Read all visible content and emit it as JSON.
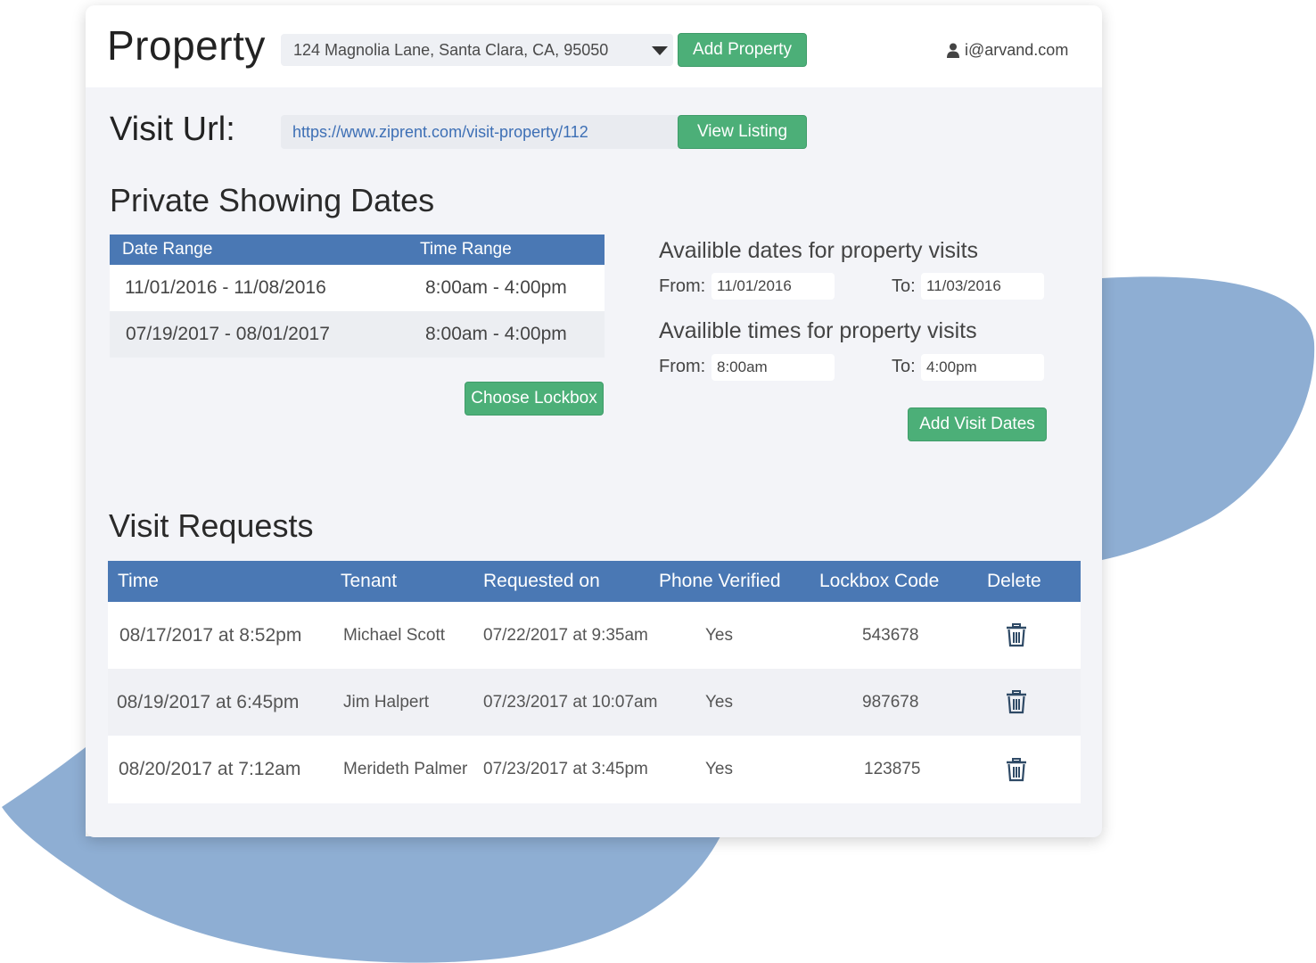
{
  "header": {
    "title": "Property",
    "property_select": "124 Magnolia Lane, Santa Clara, CA, 95050",
    "add_property_label": "Add Property",
    "user_email": "i@arvand.com"
  },
  "visit_url": {
    "label": "Visit Url:",
    "value": "https://www.ziprent.com/visit-property/112",
    "view_listing_label": "View Listing"
  },
  "private_showing": {
    "title": "Private Showing Dates",
    "columns": [
      "Date Range",
      "Time Range"
    ],
    "rows": [
      {
        "date_range": "11/01/2016 - 11/08/2016",
        "time_range": "8:00am - 4:00pm"
      },
      {
        "date_range": "07/19/2017 - 08/01/2017",
        "time_range": "8:00am - 4:00pm"
      }
    ],
    "choose_lockbox_label": "Choose Lockbox"
  },
  "availability": {
    "dates_title": "Availible dates for property visits",
    "times_title": "Availible times for property visits",
    "from_label": "From:",
    "to_label": "To:",
    "dates_from": "11/01/2016",
    "dates_to": "11/03/2016",
    "times_from": "8:00am",
    "times_to": "4:00pm",
    "add_visit_dates_label": "Add Visit Dates"
  },
  "visit_requests": {
    "title": "Visit Requests",
    "columns": [
      "Time",
      "Tenant",
      "Requested on",
      "Phone Verified",
      "Lockbox Code",
      "Delete"
    ],
    "rows": [
      {
        "time": "08/17/2017 at 8:52pm",
        "tenant": "Michael Scott",
        "requested_on": "07/22/2017 at 9:35am",
        "phone_verified": "Yes",
        "lockbox_code": "543678"
      },
      {
        "time": "08/19/2017 at 6:45pm",
        "tenant": "Jim Halpert",
        "requested_on": "07/23/2017 at 10:07am",
        "phone_verified": "Yes",
        "lockbox_code": "987678"
      },
      {
        "time": "08/20/2017 at 7:12am",
        "tenant": "Merideth Palmer",
        "requested_on": "07/23/2017 at 3:45pm",
        "phone_verified": "Yes",
        "lockbox_code": "123875"
      }
    ]
  },
  "icons": {
    "user": "user-icon",
    "dropdown": "caret-down-icon",
    "delete": "trash-icon"
  },
  "colors": {
    "accent_green": "#4caf78",
    "header_blue": "#4a78b4",
    "blob_blue": "#8eaed3",
    "link_blue": "#3d6fb5"
  }
}
